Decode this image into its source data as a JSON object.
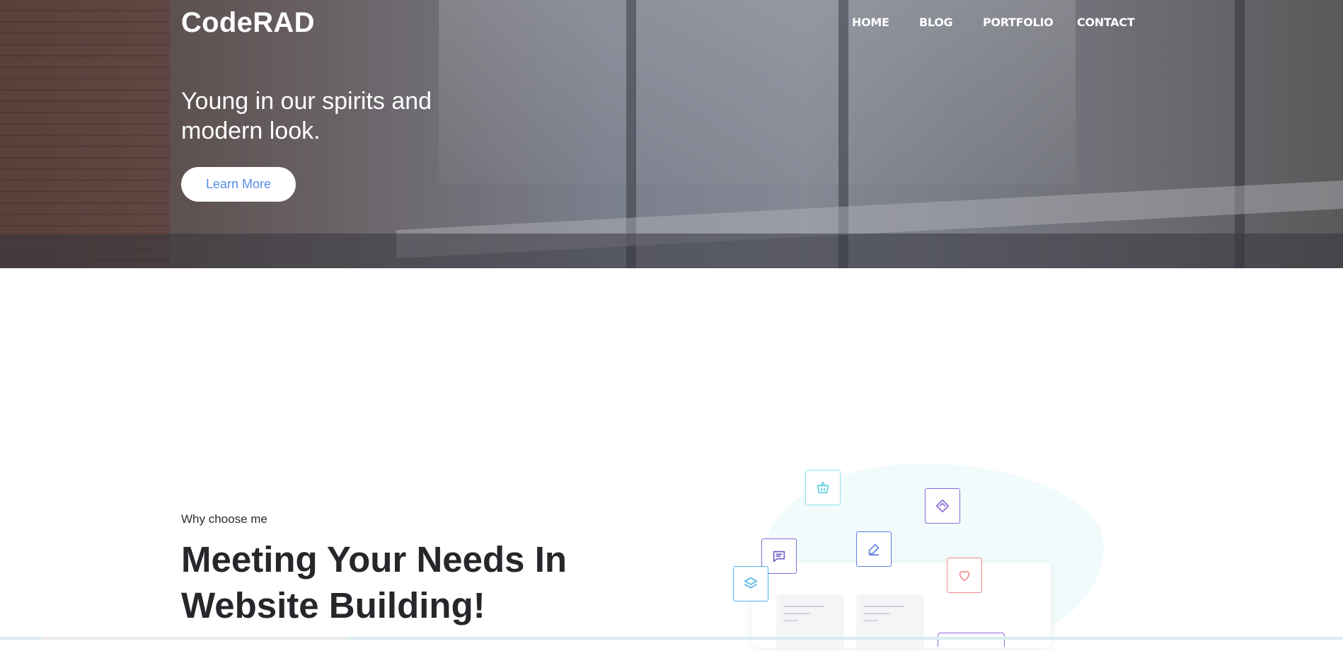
{
  "brand": {
    "name": "CodeRAD"
  },
  "nav": {
    "items": [
      {
        "label": "HOME"
      },
      {
        "label": "BLOG"
      },
      {
        "label": "PORTFOLIO"
      },
      {
        "label": "CONTACT"
      }
    ]
  },
  "hero": {
    "tagline": "Young in our spirits and modern look.",
    "cta_label": "Learn More"
  },
  "features": {
    "eyebrow": "Why choose me",
    "headline": "Meeting Your Needs In Website Building!"
  },
  "illustration": {
    "icons": [
      "basket-icon",
      "diamond-icon",
      "chat-icon",
      "edit-icon",
      "heart-icon",
      "layers-icon"
    ],
    "colors": {
      "teal": "#5fd0e0",
      "purple": "#8a6ad8",
      "blue": "#5a7de0",
      "coral": "#ee8a8a",
      "sky": "#4fb4e8"
    }
  }
}
